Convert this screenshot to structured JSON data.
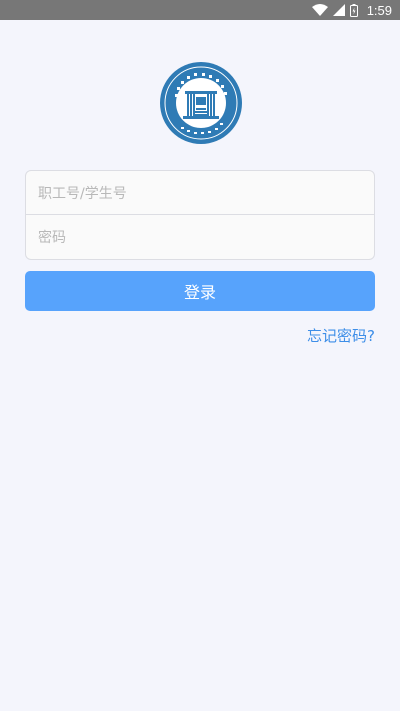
{
  "status_bar": {
    "time": "1:59",
    "icons": [
      "wifi-icon",
      "signal-icon",
      "battery-icon"
    ]
  },
  "logo": {
    "name": "school-seal-logo",
    "color": "#2f7bb5"
  },
  "form": {
    "account_placeholder": "职工号/学生号",
    "password_placeholder": "密码"
  },
  "login_button": {
    "label": "登录",
    "color": "#57a3fc"
  },
  "forgot_password": {
    "label": "忘记密码?"
  }
}
